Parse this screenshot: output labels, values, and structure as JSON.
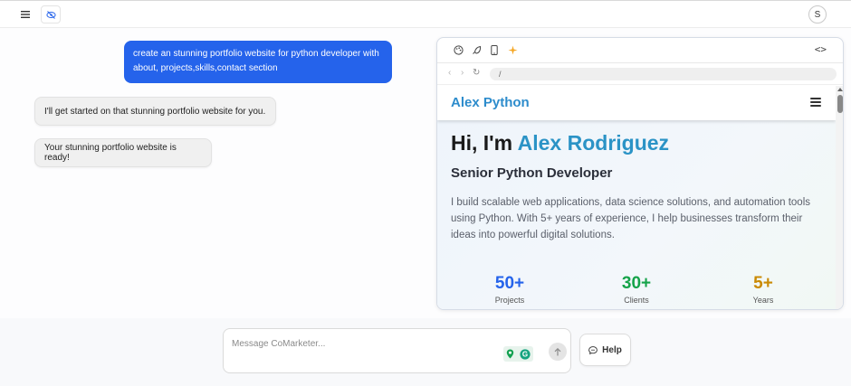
{
  "topbar": {
    "menu_icon": "hamburger-menu-icon",
    "hide_icon": "eye-off-icon",
    "avatar_initial": "S"
  },
  "chat": {
    "user_message": "create an stunning portfolio website for python developer with about, projects,skills,contact section",
    "bot_messages": [
      "I'll get started on that stunning portfolio website for you.",
      "Your stunning portfolio website is ready!"
    ]
  },
  "preview": {
    "tools": [
      "palette-icon",
      "rocket-icon",
      "mobile-icon",
      "sparkle-icon"
    ],
    "code_toggle": "<>",
    "url": "/",
    "site": {
      "brand": "Alex Python",
      "hero_prefix": "Hi, I'm ",
      "hero_name": "Alex Rodriguez",
      "subtitle": "Senior Python Developer",
      "description": "I build scalable web applications, data science solutions, and automation tools using Python. With 5+ years of experience, I help businesses transform their ideas into powerful digital solutions.",
      "stats": [
        {
          "value": "50+",
          "label": "Projects",
          "color": "#2563eb"
        },
        {
          "value": "30+",
          "label": "Clients",
          "color": "#16a34a"
        },
        {
          "value": "5+",
          "label": "Years",
          "color": "#ca8a04"
        }
      ]
    }
  },
  "composer": {
    "placeholder": "Message CoMarketer...",
    "send_icon": "arrow-up-icon"
  },
  "help": {
    "label": "Help",
    "icon": "chat-bubble-icon"
  },
  "colors": {
    "accent": "#2563eb",
    "brand": "#2d8ccc"
  }
}
